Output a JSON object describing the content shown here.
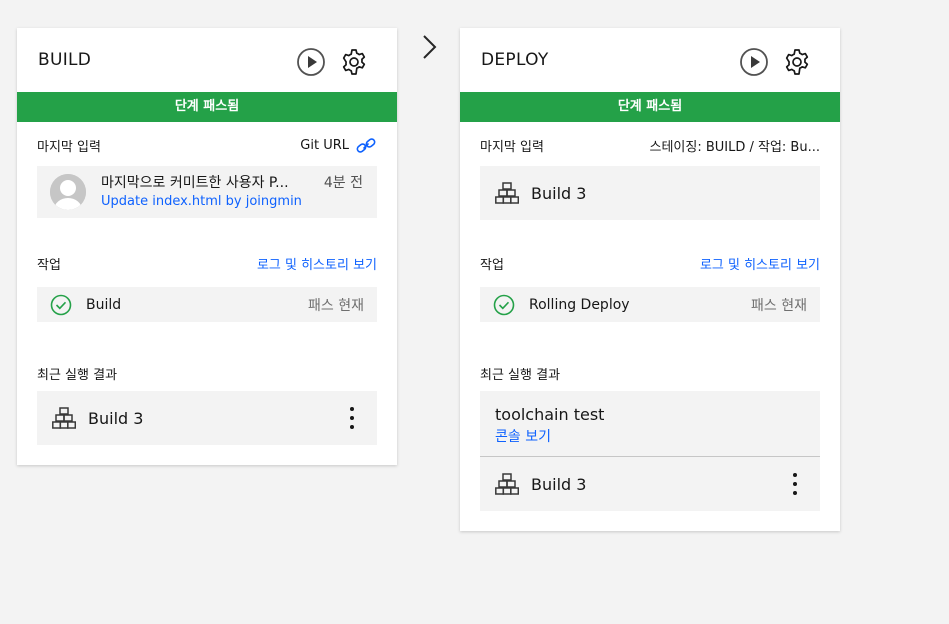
{
  "build_stage": {
    "title": "BUILD",
    "status": "단계 패스됨",
    "last_input_label": "마지막 입력",
    "input_source": "Git URL",
    "commit": {
      "message": "마지막으로 커미트한 사용자 P...",
      "time": "4분 전",
      "link": "Update index.html by joingmin"
    },
    "jobs_label": "작업",
    "logs_link": "로그 및 히스토리 보기",
    "job": {
      "name": "Build",
      "status": "패스 현재"
    },
    "recent_label": "최근 실행 결과",
    "recent_build": "Build 3"
  },
  "deploy_stage": {
    "title": "DEPLOY",
    "status": "단계 패스됨",
    "last_input_label": "마지막 입력",
    "input_source": "스테이징: BUILD  /  작업: Bu...",
    "input_build": "Build 3",
    "jobs_label": "작업",
    "logs_link": "로그 및 히스토리 보기",
    "job": {
      "name": "Rolling Deploy",
      "status": "패스 현재"
    },
    "recent_label": "최근 실행 결과",
    "recent_run": {
      "name": "toolchain test",
      "console_link": "콘솔 보기",
      "build": "Build 3"
    }
  },
  "colors": {
    "success_green": "#24a148",
    "link_blue": "#0f62fe",
    "tile_bg": "#f3f3f3"
  },
  "icons": [
    "play-icon",
    "gear-icon",
    "link-icon",
    "check-circle-icon",
    "build-blocks-icon",
    "overflow-menu-icon",
    "chevron-right-icon",
    "avatar-icon"
  ]
}
